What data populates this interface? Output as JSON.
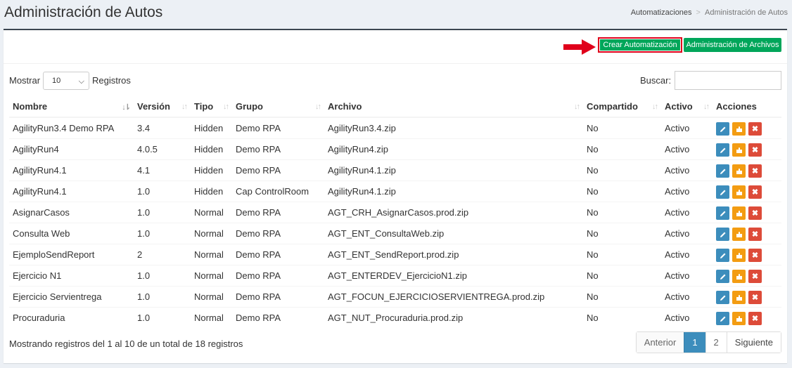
{
  "header": {
    "title": "Administración de Autos"
  },
  "breadcrumb": {
    "items": [
      "Automatizaciones",
      "Administración de Autos"
    ]
  },
  "toolbar": {
    "create_label": "Crear Automatización",
    "files_label": "Administración de Archivos"
  },
  "controls": {
    "show_label": "Mostrar",
    "page_size": "10",
    "records_label": "Registros",
    "search_label": "Buscar:",
    "search_value": ""
  },
  "table": {
    "columns": [
      "Nombre",
      "Versión",
      "Tipo",
      "Grupo",
      "Archivo",
      "Compartido",
      "Activo",
      "Acciones"
    ],
    "rows": [
      [
        "AgilityRun3.4 Demo RPA",
        "3.4",
        "Hidden",
        "Demo RPA",
        "AgilityRun3.4.zip",
        "No",
        "Activo"
      ],
      [
        "AgilityRun4",
        "4.0.5",
        "Hidden",
        "Demo RPA",
        "AgilityRun4.zip",
        "No",
        "Activo"
      ],
      [
        "AgilityRun4.1",
        "4.1",
        "Hidden",
        "Demo RPA",
        "AgilityRun4.1.zip",
        "No",
        "Activo"
      ],
      [
        "AgilityRun4.1",
        "1.0",
        "Hidden",
        "Cap ControlRoom",
        "AgilityRun4.1.zip",
        "No",
        "Activo"
      ],
      [
        "AsignarCasos",
        "1.0",
        "Normal",
        "Demo RPA",
        "AGT_CRH_AsignarCasos.prod.zip",
        "No",
        "Activo"
      ],
      [
        "Consulta Web",
        "1.0",
        "Normal",
        "Demo RPA",
        "AGT_ENT_ConsultaWeb.zip",
        "No",
        "Activo"
      ],
      [
        "EjemploSendReport",
        "2",
        "Normal",
        "Demo RPA",
        "AGT_ENT_SendReport.prod.zip",
        "No",
        "Activo"
      ],
      [
        "Ejercicio N1",
        "1.0",
        "Normal",
        "Demo RPA",
        "AGT_ENTERDEV_EjercicioN1.zip",
        "No",
        "Activo"
      ],
      [
        "Ejercicio Servientrega",
        "1.0",
        "Normal",
        "Demo RPA",
        "AGT_FOCUN_EJERCICIOSERVIENTREGA.prod.zip",
        "No",
        "Activo"
      ],
      [
        "Procuraduria",
        "1.0",
        "Normal",
        "Demo RPA",
        "AGT_NUT_Procuraduria.prod.zip",
        "No",
        "Activo"
      ]
    ]
  },
  "footer": {
    "info": "Mostrando registros del 1 al 10 de un total de 18 registros"
  },
  "pagination": {
    "prev": "Anterior",
    "pages": [
      "1",
      "2"
    ],
    "current": "1",
    "next": "Siguiente"
  },
  "icons": {
    "edit": "pencil-icon",
    "plugin": "puzzle-icon",
    "delete": "times-icon"
  },
  "colors": {
    "success": "#00a65a",
    "primary": "#3c8dbc",
    "warning": "#f39c12",
    "danger": "#dd4b39",
    "highlight": "#e0001b"
  }
}
